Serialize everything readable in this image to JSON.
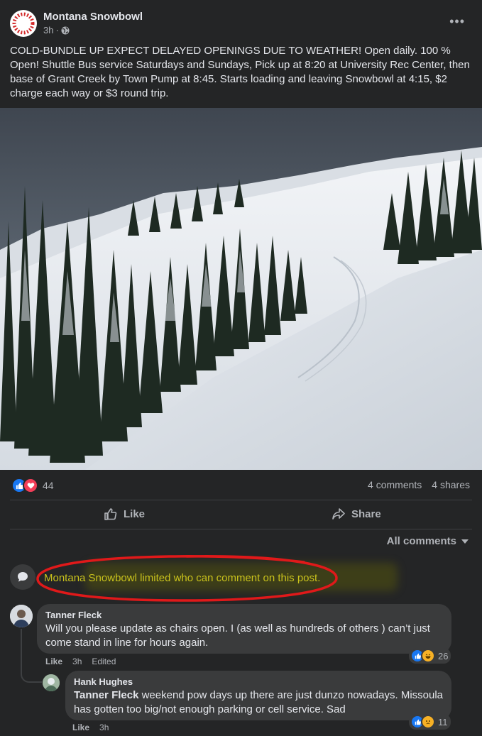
{
  "post": {
    "page_name": "Montana Snowbowl",
    "time": "3h",
    "audience_icon": "globe-icon",
    "text": "COLD-BUNDLE UP EXPECT DELAYED OPENINGS DUE TO WEATHER! Open daily. 100 % Open! Shuttle Bus service Saturdays and Sundays, Pick up at 8:20 at University Rec Center, then base of Grant Creek by Town Pump at 8:45. Starts loading and leaving Snowbowl at 4:15, $2 charge each way or $3 round trip.",
    "more_icon": "•••"
  },
  "stats": {
    "reaction_count": "44",
    "comments": "4 comments",
    "shares": "4 shares"
  },
  "actions": {
    "like": "Like",
    "share": "Share"
  },
  "comments_filter": "All comments",
  "limited_notice": "Montana Snowbowl limited who can comment on this post.",
  "comments": [
    {
      "author": "Tanner Fleck",
      "text": "Will you please update as chairs open. I (as well as hundreds of others ) can’t just come stand in line for hours again.",
      "like": "Like",
      "time": "3h",
      "edited": "Edited",
      "reactions": "26"
    },
    {
      "author": "Hank Hughes",
      "mention": "Tanner Fleck",
      "text": " weekend pow days up there are just dunzo nowadays. Missoula has gotten too big/not enough parking or cell service. Sad",
      "like": "Like",
      "time": "3h",
      "reactions": "11"
    }
  ],
  "colors": {
    "like_blue": "#1877f2",
    "love_red": "#f33e58",
    "notice_yellow": "#c9c21c",
    "highlight_red": "#e0191a"
  }
}
